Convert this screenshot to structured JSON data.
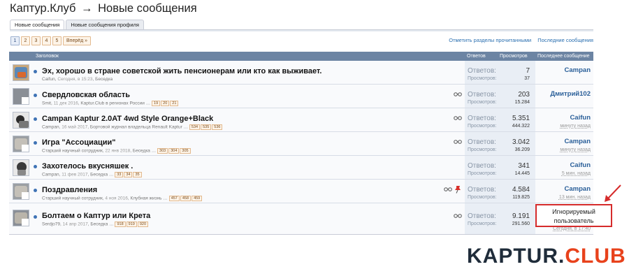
{
  "page_title": {
    "forum": "Каптур.Клуб",
    "arrow": "→",
    "section": "Новые сообщения"
  },
  "tabs": [
    {
      "label": "Новые сообщения",
      "active": true
    },
    {
      "label": "Новые сообщения профиля",
      "active": false
    }
  ],
  "pager": {
    "pages": [
      "1",
      "2",
      "3",
      "4",
      "5"
    ],
    "current": "1",
    "next_label": "Вперёд »"
  },
  "top_links": {
    "mark_read": "Отметить разделы прочитанными",
    "latest": "Последние сообщения"
  },
  "list_header": {
    "title": "Заголовок",
    "replies": "Ответов",
    "views": "Просмотров",
    "last_post": "Последнее сообщение"
  },
  "stats_labels": {
    "replies": "Ответов:",
    "views": "Просмотров:"
  },
  "threads": [
    {
      "title": "Эх, хорошо в стране советской жить пенсионерам или кто как выживает.",
      "author": "Caifun",
      "date": "Сегодня, в 15:23",
      "forum": "Беседка",
      "pages": [],
      "replies": "7",
      "views": "37",
      "last_user": "Campan",
      "last_time": ""
    },
    {
      "title": "Свердловская область",
      "author": "Smit",
      "date": "11 дек 2016",
      "forum": "Kaptur.Club в регионах России",
      "pages": [
        "19",
        "20",
        "21"
      ],
      "replies": "203",
      "views": "15.284",
      "last_user": "Дмитрий102",
      "last_time": ""
    },
    {
      "title": "Campan Kaptur 2.0AT 4wd Style Orange+Black",
      "author": "Campan",
      "date": "16 май 2017",
      "forum": "Бортовой журнал владельца Renault Kaptur",
      "pages": [
        "534",
        "535",
        "536"
      ],
      "replies": "5.351",
      "views": "444.322",
      "last_user": "Caifun",
      "last_time": "минуту назад"
    },
    {
      "title": "Игра \"Ассоциации\"",
      "author": "Старший научный сотрудник",
      "date": "22 янв 2018",
      "forum": "Беседка",
      "pages": [
        "303",
        "304",
        "305"
      ],
      "replies": "3.042",
      "views": "36.209",
      "last_user": "Campan",
      "last_time": "минуту назад"
    },
    {
      "title": "Захотелось вкусняшек .",
      "author": "Campan",
      "date": "11 фев 2017",
      "forum": "Беседка",
      "pages": [
        "33",
        "34",
        "35"
      ],
      "replies": "341",
      "views": "14.445",
      "last_user": "Caifun",
      "last_time": "5 мин. назад"
    },
    {
      "title": "Поздравления",
      "author": "Старший научный сотрудник",
      "date": "4 ноя 2016",
      "forum": "Клубная жизнь",
      "pages": [
        "457",
        "458",
        "459"
      ],
      "replies": "4.584",
      "views": "119.825",
      "last_user": "Campan",
      "last_time": "13 мин. назад"
    },
    {
      "title": "Болтаем о Каптур или Крета",
      "author": "Serdjo79",
      "date": "14 апр 2017",
      "forum": "Беседка",
      "pages": [
        "918",
        "919",
        "920"
      ],
      "replies": "9.191",
      "views": "291.560",
      "last_user": "",
      "last_time": "Сегодня, в 17:40"
    }
  ],
  "ignored_notice": {
    "line1": "Игнорируемый",
    "line2": "пользователь"
  },
  "logo": {
    "part1": "KAPTUR.",
    "part2": "CLUB"
  },
  "colors": {
    "header_bar": "#6c84a3",
    "link": "#2a5f99",
    "stats_bg": "#e9eef5",
    "highlight": "#d62b2b",
    "logo_accent": "#e8421c"
  }
}
